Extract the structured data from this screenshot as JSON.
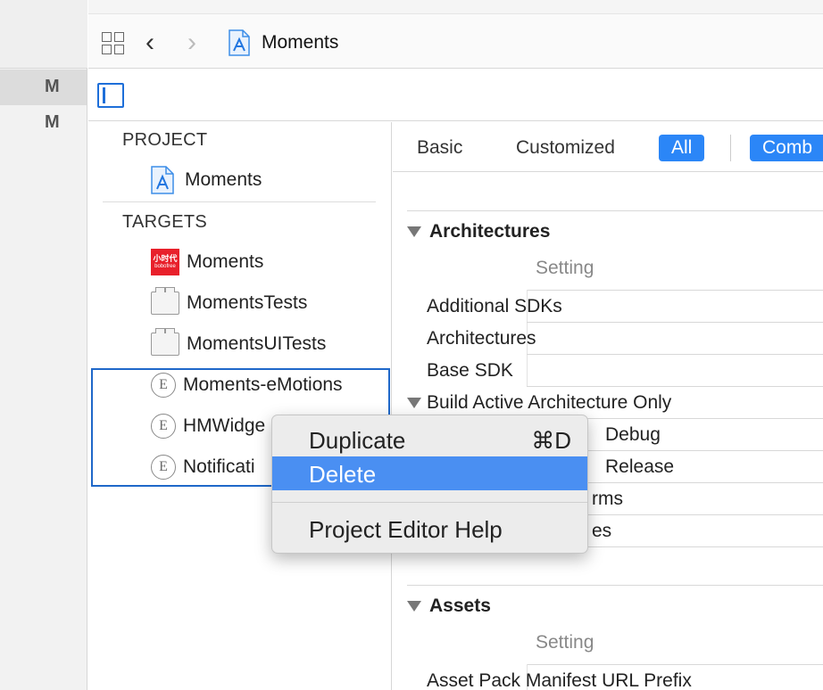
{
  "gutter": {
    "rows": [
      "M",
      "M"
    ]
  },
  "toolbar": {
    "breadcrumb_title": "Moments"
  },
  "navigator": {
    "project_header": "PROJECT",
    "project_item": "Moments",
    "targets_header": "TARGETS",
    "brand_icon_text": "小时代",
    "brand_icon_sub": "bobofree",
    "targets": [
      {
        "label": "Moments",
        "icon": "app-brand-icon"
      },
      {
        "label": "MomentsTests",
        "icon": "bundle-icon"
      },
      {
        "label": "MomentsUITests",
        "icon": "bundle-icon"
      },
      {
        "label": "Moments-eMotions",
        "icon": "extension-icon"
      },
      {
        "label": "HMWidge",
        "icon": "extension-icon"
      },
      {
        "label": "Notificati",
        "icon": "extension-icon"
      }
    ],
    "extension_glyph": "E"
  },
  "filters": {
    "basic": "Basic",
    "customized": "Customized",
    "all": "All",
    "combined": "Comb"
  },
  "settings": {
    "architectures_group": "Architectures",
    "setting_col": "Setting",
    "rows": [
      "Additional SDKs",
      "Architectures",
      "Base SDK"
    ],
    "build_active": "Build Active Architecture Only",
    "debug": "Debug",
    "release": "Release",
    "partial_rows": [
      "rms",
      "es"
    ],
    "assets_group": "Assets",
    "assets_setting_col": "Setting",
    "asset_pack_row": "Asset Pack Manifest URL Prefix"
  },
  "context_menu": {
    "duplicate": "Duplicate",
    "duplicate_shortcut": "⌘D",
    "delete": "Delete",
    "help": "Project Editor Help"
  },
  "colors": {
    "accent": "#2b86f7",
    "menu_highlight": "#4a8ff2",
    "drop_outline": "#1f68c9",
    "brand_red": "#e8202b"
  }
}
